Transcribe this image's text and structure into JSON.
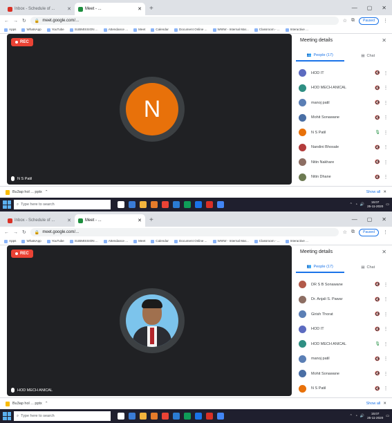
{
  "screens": [
    {
      "tabs": [
        {
          "title": "Inbox - Schedule of ...",
          "active": false,
          "fav": "#d93025"
        },
        {
          "title": "Meet - ...",
          "active": true,
          "fav": "#1e8e3e"
        }
      ],
      "url": "meet.google.com/...",
      "profile": "Paused",
      "bookmarks": [
        "Apps",
        "WhatsApp",
        "YouTube",
        "SUBMISSION ...",
        "Attendance ...",
        "Meet",
        "Calendar",
        "Document Online ...",
        "WWW - Internal Mar...",
        "Classroom - ...",
        "Interactive ..."
      ],
      "rec": "REC",
      "presenter": {
        "initial": "N",
        "name": "N S Patil",
        "kind": "initial"
      },
      "pane_title": "Meeting details",
      "pane_close": "✕",
      "people_tab": "People (17)",
      "chat_tab": "Chat",
      "participants": [
        {
          "name": "HOD IT",
          "color": "#5c6bc0",
          "mic": "🔇",
          "mic_on": false
        },
        {
          "name": "HOD MECH ANICAL",
          "color": "#2f8f83",
          "mic": "🔇",
          "mic_on": false
        },
        {
          "name": "manoj patil",
          "color": "#5b7fb5",
          "mic": "🔇",
          "mic_on": false
        },
        {
          "name": "Mohit Sonawane",
          "color": "#4a6fa5",
          "mic": "🔇",
          "mic_on": false
        },
        {
          "name": "N S Patil",
          "color": "#e8710a",
          "mic": "🎙",
          "mic_on": true
        },
        {
          "name": "Nandini Bhosale",
          "color": "#b33c3c",
          "mic": "🔇",
          "mic_on": false
        },
        {
          "name": "Nitin Nakhare",
          "color": "#8d6e63",
          "mic": "🔇",
          "mic_on": false
        },
        {
          "name": "Nitin Dhane",
          "color": "#6d7a52",
          "mic": "🔇",
          "mic_on": false
        }
      ],
      "download": "Bu3ap hol ... pptx",
      "show_all": "Show all",
      "search": "Type here to search",
      "time": "15:07",
      "date": "25-11-2020"
    },
    {
      "tabs": [
        {
          "title": "Inbox - Schedule of ...",
          "active": false,
          "fav": "#d93025"
        },
        {
          "title": "Meet - ...",
          "active": true,
          "fav": "#1e8e3e"
        }
      ],
      "url": "meet.google.com/...",
      "profile": "Paused",
      "bookmarks": [
        "Apps",
        "WhatsApp",
        "YouTube",
        "SUBMISSION ...",
        "Attendance ...",
        "Meet",
        "Calendar",
        "Document Online ...",
        "WWW - Internal Mar...",
        "Classroom - ...",
        "Interactive ..."
      ],
      "rec": "REC",
      "presenter": {
        "initial": "",
        "name": "HOD MECH ANICAL",
        "kind": "photo"
      },
      "pane_title": "Meeting details",
      "pane_close": "✕",
      "people_tab": "People (17)",
      "chat_tab": "Chat",
      "participants": [
        {
          "name": "DR S B Sonawane",
          "color": "#b35a4a",
          "mic": "🔇",
          "mic_on": false
        },
        {
          "name": "Dr. Anjali S. Pawar",
          "color": "#8d6e63",
          "mic": "🔇",
          "mic_on": false
        },
        {
          "name": "Girish Thorat",
          "color": "#5b7fb5",
          "mic": "🔇",
          "mic_on": false
        },
        {
          "name": "HOD IT",
          "color": "#5c6bc0",
          "mic": "🔇",
          "mic_on": false
        },
        {
          "name": "HOD MECH ANICAL",
          "color": "#2f8f83",
          "mic": "🎙",
          "mic_on": true
        },
        {
          "name": "manoj patil",
          "color": "#5b7fb5",
          "mic": "🔇",
          "mic_on": false
        },
        {
          "name": "Mohit Sonawane",
          "color": "#4a6fa5",
          "mic": "🔇",
          "mic_on": false
        },
        {
          "name": "N S Patil",
          "color": "#e8710a",
          "mic": "🔇",
          "mic_on": false
        }
      ],
      "download": "Bu3ap hol ... pptx",
      "show_all": "Show all",
      "search": "Type here to search",
      "time": "15:07",
      "date": "25-11-2020"
    }
  ]
}
